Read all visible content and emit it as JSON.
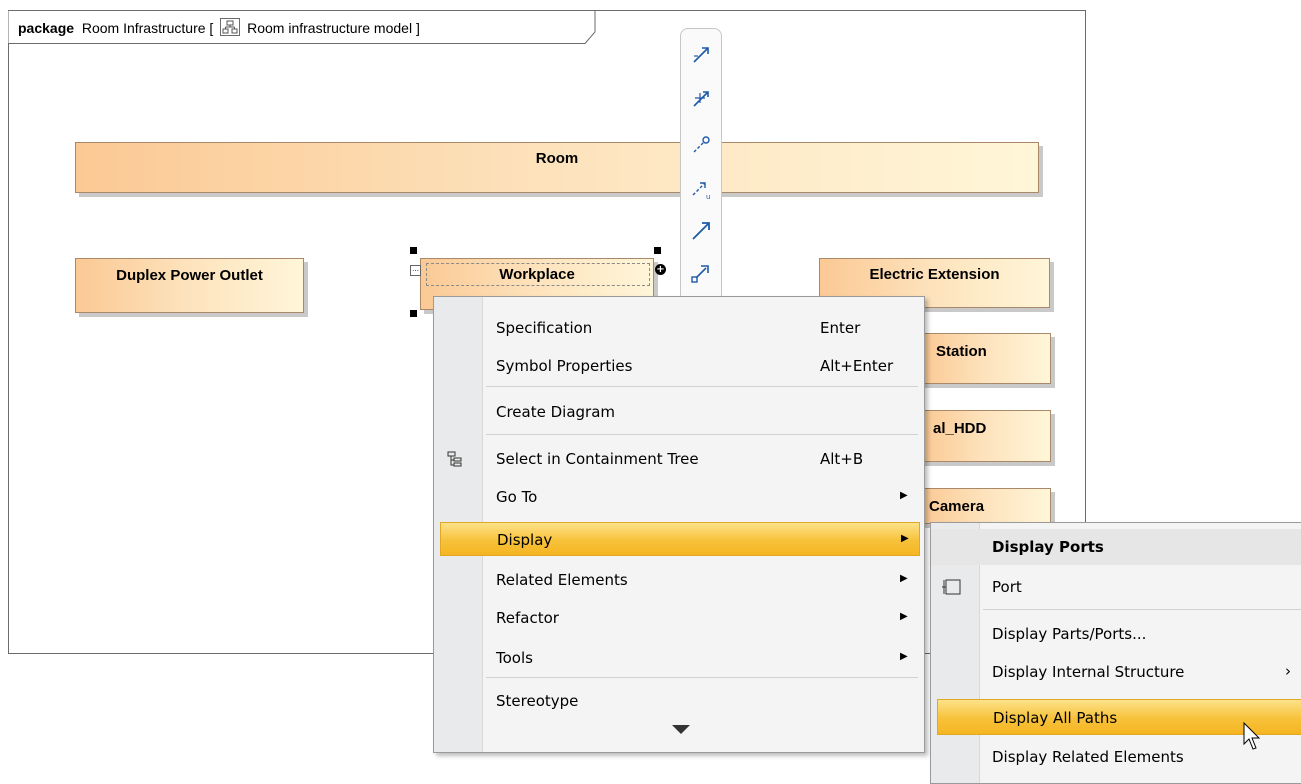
{
  "package": {
    "keyword": "package",
    "name": "Room Infrastructure [",
    "diagram_name": "Room infrastructure model ]"
  },
  "blocks": {
    "room": "Room",
    "duplex_power_outlet": "Duplex Power Outlet",
    "workplace": "Workplace",
    "electric_extension": "Electric Extension",
    "station": "Station",
    "hdd": "al_HDD",
    "camera": "Camera"
  },
  "context_menu": {
    "items": [
      {
        "label": "Specification",
        "shortcut": "Enter"
      },
      {
        "label": "Symbol Properties",
        "shortcut": "Alt+Enter"
      },
      {
        "label": "Create Diagram",
        "shortcut": ""
      },
      {
        "label": "Select in Containment Tree",
        "shortcut": "Alt+B",
        "icon": "containment-tree-icon"
      },
      {
        "label": "Go To",
        "submenu": true
      },
      {
        "label": "Display",
        "submenu": true,
        "highlighted": true
      },
      {
        "label": "Related Elements",
        "submenu": true
      },
      {
        "label": "Refactor",
        "submenu": true
      },
      {
        "label": "Tools",
        "submenu": true
      },
      {
        "label": "Stereotype",
        "shortcut": ""
      }
    ],
    "scroll_down_icon": "triangle-down-icon"
  },
  "display_submenu": {
    "header": "Display Ports",
    "items": [
      {
        "label": "Port",
        "icon": "port-icon"
      },
      {
        "label": "Display Parts/Ports..."
      },
      {
        "label": "Display Internal Structure",
        "submenu": true
      },
      {
        "label": "Display All Paths",
        "highlighted": true
      },
      {
        "label": "Display Related Elements"
      }
    ]
  },
  "colors": {
    "highlight": "#f7c23a",
    "block_fill_left": "#fbc994",
    "block_fill_right": "#fff6d8",
    "toolbar_icon": "#1e5aa8"
  }
}
